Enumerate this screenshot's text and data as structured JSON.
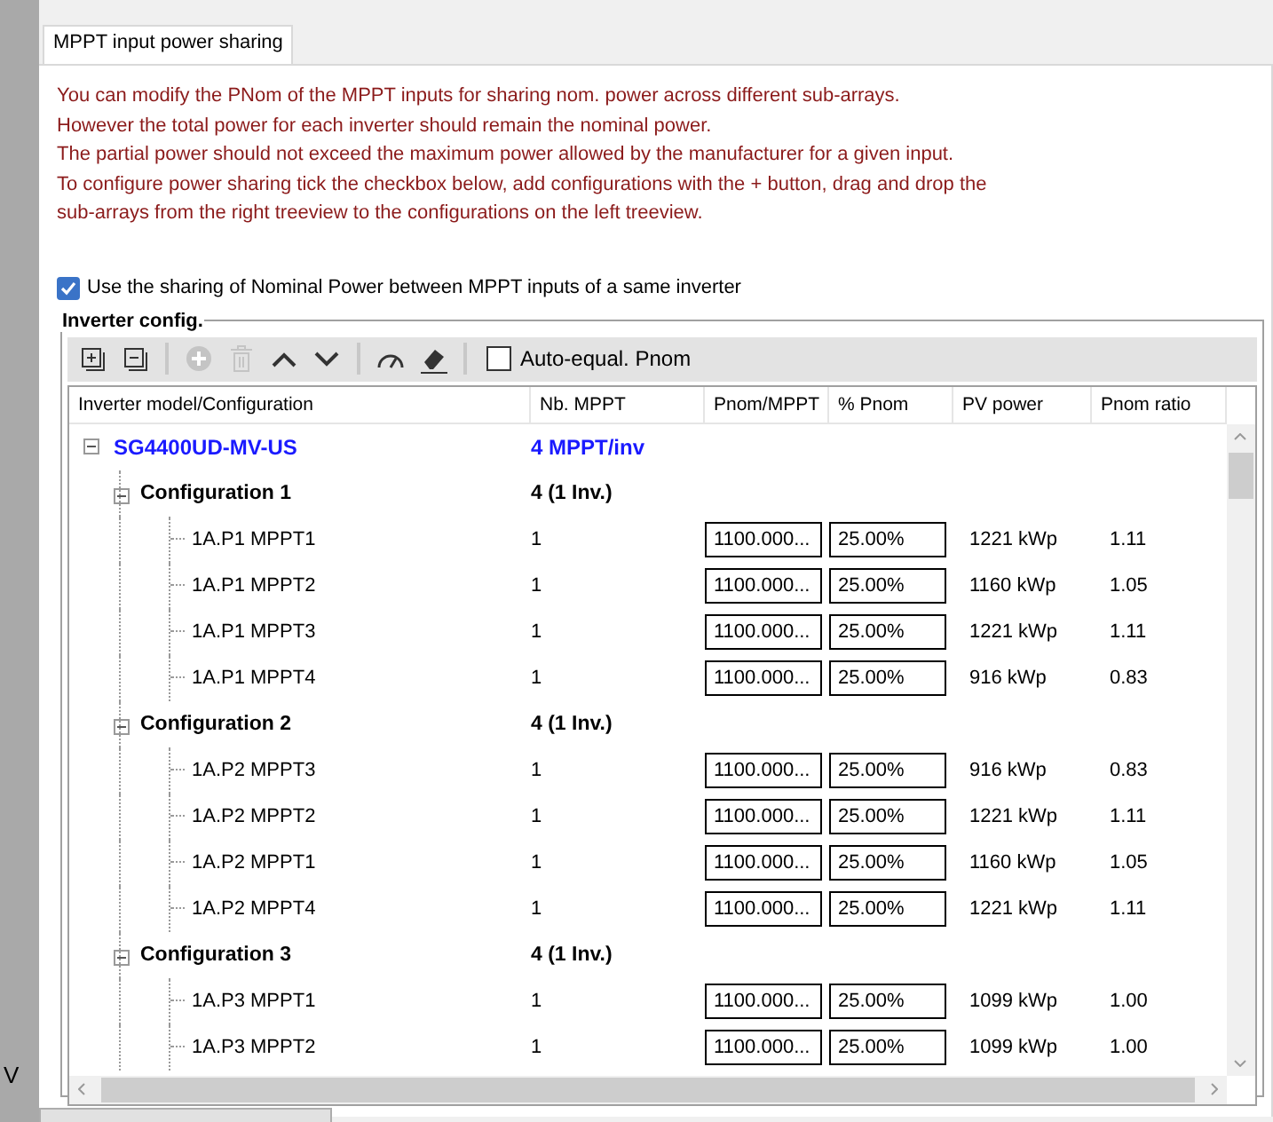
{
  "background_fragment": "V",
  "tab": {
    "label": "MPPT input power sharing",
    "selected": true
  },
  "info_lines": [
    "You can modify the PNom of the MPPT inputs for sharing nom. power across different sub-arrays.",
    "However the total power for each inverter should remain the nominal power.",
    "The partial power should not exceed the maximum power allowed by the manufacturer for a given input.",
    "To configure power sharing tick the checkbox below, add configurations with the + button, drag and drop the",
    "sub-arrays from the right treeview to the configurations on the left treeview."
  ],
  "sharing_checkbox": {
    "label": "Use the sharing of Nominal Power between MPPT inputs of a same inverter",
    "checked": true
  },
  "group": {
    "title": "Inverter config.",
    "toolbar": {
      "buttons": [
        {
          "kind": "expand_all",
          "disabled": false
        },
        {
          "kind": "collapse_all",
          "disabled": false
        },
        {
          "kind": "add",
          "disabled": true
        },
        {
          "kind": "delete",
          "disabled": true
        },
        {
          "kind": "up",
          "disabled": false
        },
        {
          "kind": "down",
          "disabled": false
        },
        {
          "kind": "gauge",
          "disabled": false
        },
        {
          "kind": "eraser",
          "disabled": false
        }
      ],
      "auto_equal": {
        "label": "Auto-equal. Pnom",
        "checked": false
      }
    },
    "columns": [
      "Inverter model/Configuration",
      "Nb. MPPT",
      "Pnom/MPPT",
      "% Pnom",
      "PV power",
      "Pnom ratio"
    ],
    "tree": [
      {
        "name": "SG4400UD-MV-US",
        "nb_mppt": "4 MPPT/inv",
        "expanded": true,
        "children": [
          {
            "name": "Configuration 1",
            "nb_mppt": "4 (1 Inv.)",
            "expanded": true,
            "children": [
              {
                "name": "1A.P1 MPPT1",
                "nb_mppt": "1",
                "pnom": "1100.000...",
                "pct": "25.00%",
                "pv_power": "1221 kWp",
                "ratio": "1.11"
              },
              {
                "name": "1A.P1 MPPT2",
                "nb_mppt": "1",
                "pnom": "1100.000...",
                "pct": "25.00%",
                "pv_power": "1160 kWp",
                "ratio": "1.05"
              },
              {
                "name": "1A.P1 MPPT3",
                "nb_mppt": "1",
                "pnom": "1100.000...",
                "pct": "25.00%",
                "pv_power": "1221 kWp",
                "ratio": "1.11"
              },
              {
                "name": "1A.P1 MPPT4",
                "nb_mppt": "1",
                "pnom": "1100.000...",
                "pct": "25.00%",
                "pv_power": "916 kWp",
                "ratio": "0.83"
              }
            ]
          },
          {
            "name": "Configuration 2",
            "nb_mppt": "4 (1 Inv.)",
            "expanded": true,
            "children": [
              {
                "name": "1A.P2 MPPT3",
                "nb_mppt": "1",
                "pnom": "1100.000...",
                "pct": "25.00%",
                "pv_power": "916 kWp",
                "ratio": "0.83"
              },
              {
                "name": "1A.P2 MPPT2",
                "nb_mppt": "1",
                "pnom": "1100.000...",
                "pct": "25.00%",
                "pv_power": "1221 kWp",
                "ratio": "1.11"
              },
              {
                "name": "1A.P2 MPPT1",
                "nb_mppt": "1",
                "pnom": "1100.000...",
                "pct": "25.00%",
                "pv_power": "1160 kWp",
                "ratio": "1.05"
              },
              {
                "name": "1A.P2 MPPT4",
                "nb_mppt": "1",
                "pnom": "1100.000...",
                "pct": "25.00%",
                "pv_power": "1221 kWp",
                "ratio": "1.11"
              }
            ]
          },
          {
            "name": "Configuration 3",
            "nb_mppt": "4 (1 Inv.)",
            "expanded": true,
            "children": [
              {
                "name": "1A.P3 MPPT1",
                "nb_mppt": "1",
                "pnom": "1100.000...",
                "pct": "25.00%",
                "pv_power": "1099 kWp",
                "ratio": "1.00"
              },
              {
                "name": "1A.P3 MPPT2",
                "nb_mppt": "1",
                "pnom": "1100.000...",
                "pct": "25.00%",
                "pv_power": "1099 kWp",
                "ratio": "1.00"
              }
            ]
          }
        ]
      }
    ]
  }
}
